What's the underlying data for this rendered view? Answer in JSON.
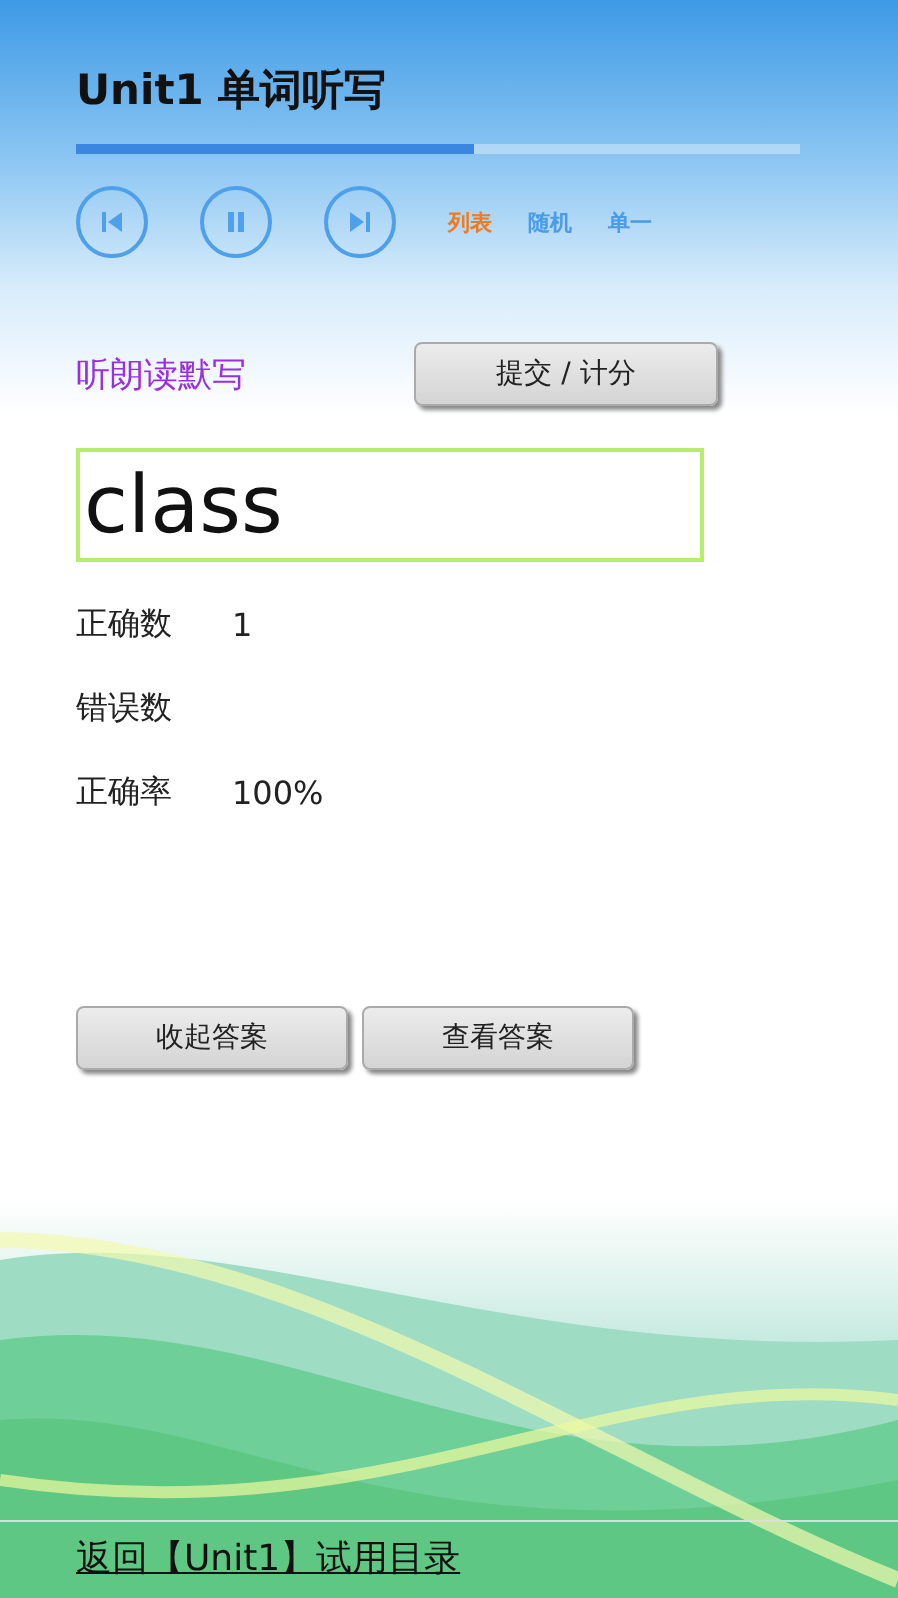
{
  "title": "Unit1 单词听写",
  "progress": {
    "level": 0.55
  },
  "player_buttons": [
    {
      "kind": "previous"
    },
    {
      "kind": "pause"
    },
    {
      "kind": "next"
    }
  ],
  "play_modes": [
    {
      "label": "列表",
      "selected": true
    },
    {
      "label": "随机",
      "selected": false
    },
    {
      "label": "单一",
      "selected": false
    }
  ],
  "dictation": {
    "label": "听朗读默写",
    "submit_button": "提交 / 计分",
    "answer": "class"
  },
  "stats": [
    {
      "label": "正确数",
      "value": "1"
    },
    {
      "label": "错误数"
    },
    {
      "label": "正确率",
      "value": "100%"
    }
  ],
  "answer_buttons": [
    "收起答案",
    "查看答案"
  ],
  "back_link": "返回【Unit1】试用目录"
}
